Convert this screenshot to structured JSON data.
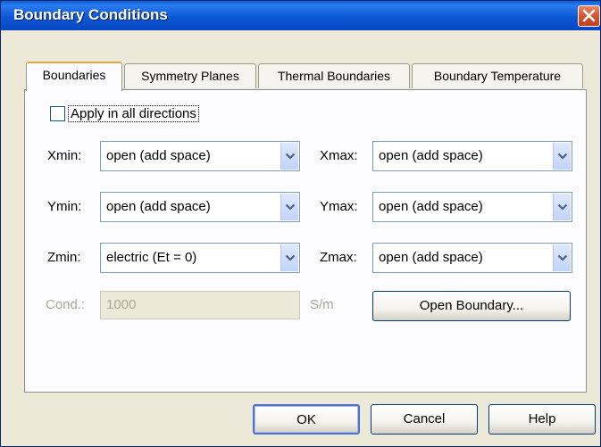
{
  "window": {
    "title": "Boundary Conditions",
    "title_bar_color": "#0a5fd8"
  },
  "tabs": [
    {
      "label": "Boundaries",
      "active": true
    },
    {
      "label": "Symmetry Planes",
      "active": false
    },
    {
      "label": "Thermal Boundaries",
      "active": false
    },
    {
      "label": "Boundary Temperature",
      "active": false
    }
  ],
  "apply_all": {
    "label": "Apply in all directions",
    "checked": false
  },
  "fields": {
    "xmin": {
      "label": "Xmin:",
      "value": "open (add space)"
    },
    "xmax": {
      "label": "Xmax:",
      "value": "open (add space)"
    },
    "ymin": {
      "label": "Ymin:",
      "value": "open (add space)"
    },
    "ymax": {
      "label": "Ymax:",
      "value": "open (add space)"
    },
    "zmin": {
      "label": "Zmin:",
      "value": "electric (Et = 0)"
    },
    "zmax": {
      "label": "Zmax:",
      "value": "open (add space)"
    }
  },
  "cond": {
    "label": "Cond.:",
    "value": "1000",
    "unit": "S/m"
  },
  "buttons": {
    "open_boundary": "Open Boundary...",
    "ok": "OK",
    "cancel": "Cancel",
    "help": "Help"
  },
  "icons": {
    "close": "close-icon",
    "dropdown": "chevron-down-icon"
  }
}
